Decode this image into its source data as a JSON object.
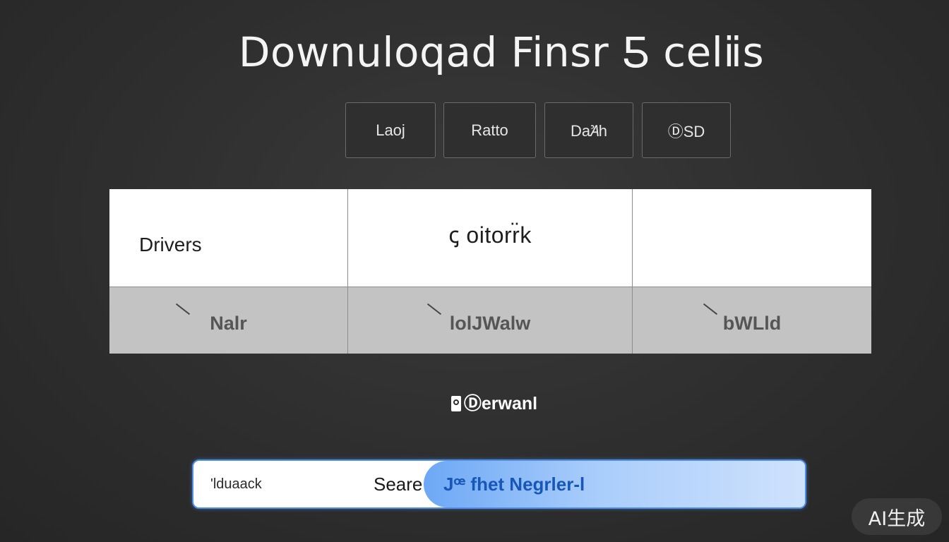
{
  "header": {
    "title": "Downuloqad Finsr Ƽ celⅱs"
  },
  "tabs": [
    {
      "label": "Laoj"
    },
    {
      "label": "Ratto"
    },
    {
      "label": "DaꞺh"
    },
    {
      "label": "ⒹSD"
    }
  ],
  "table": {
    "header_cells": [
      "Drivers",
      "ꞔ oitorr̈k",
      ""
    ],
    "row_cells": [
      "Nalr",
      "lolJWalw",
      "bWLld"
    ]
  },
  "download": {
    "label": "Ⓓerwanl"
  },
  "search": {
    "input_value": "'lduaack",
    "label": "Seare",
    "button_label": "Jꟹ fhet Negrler-l"
  },
  "watermark": {
    "text": "AI生成"
  }
}
